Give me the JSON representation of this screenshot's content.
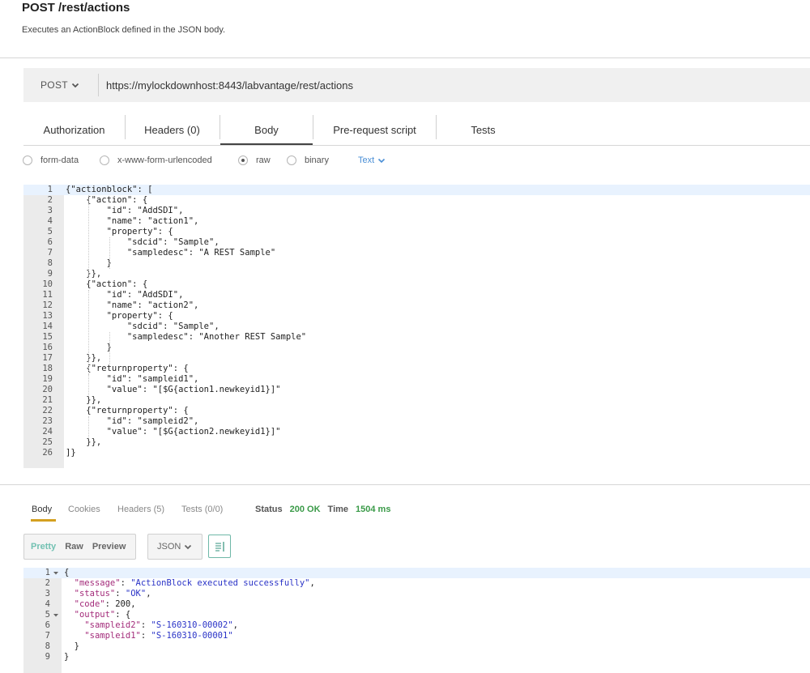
{
  "header": {
    "title": "POST /rest/actions",
    "subtitle": "Executes an ActionBlock defined in the JSON body."
  },
  "request": {
    "method": "POST",
    "url": "https://mylockdownhost:8443/labvantage/rest/actions"
  },
  "tabs": [
    {
      "label": "Authorization"
    },
    {
      "label": "Headers (0)"
    },
    {
      "label": "Body"
    },
    {
      "label": "Pre-request script"
    },
    {
      "label": "Tests"
    }
  ],
  "active_tab": "Body",
  "body_modes": [
    {
      "label": "form-data"
    },
    {
      "label": "x-www-form-urlencoded"
    },
    {
      "label": "raw"
    },
    {
      "label": "binary"
    }
  ],
  "selected_body_mode": "raw",
  "raw_type": "Text",
  "request_body_lines": [
    "{\"actionblock\": [",
    "    {\"action\": {",
    "        \"id\": \"AddSDI\",",
    "        \"name\": \"action1\",",
    "        \"property\": {",
    "            \"sdcid\": \"Sample\",",
    "            \"sampledesc\": \"A REST Sample\"",
    "        }",
    "    }},",
    "    {\"action\": {",
    "        \"id\": \"AddSDI\",",
    "        \"name\": \"action2\",",
    "        \"property\": {",
    "            \"sdcid\": \"Sample\",",
    "            \"sampledesc\": \"Another REST Sample\"",
    "        }",
    "    }},",
    "    {\"returnproperty\": {",
    "        \"id\": \"sampleid1\",",
    "        \"value\": \"[$G{action1.newkeyid1}]\"",
    "    }},",
    "    {\"returnproperty\": {",
    "        \"id\": \"sampleid2\",",
    "        \"value\": \"[$G{action2.newkeyid1}]\"",
    "    }},",
    "]}"
  ],
  "response": {
    "tabs": [
      {
        "label": "Body"
      },
      {
        "label": "Cookies"
      },
      {
        "label": "Headers (5)"
      },
      {
        "label": "Tests (0/0)"
      }
    ],
    "active_tab": "Body",
    "status_label": "Status",
    "status_value": "200 OK",
    "time_label": "Time",
    "time_value": "1504 ms",
    "view_modes": [
      {
        "label": "Pretty"
      },
      {
        "label": "Raw"
      },
      {
        "label": "Preview"
      }
    ],
    "selected_view_mode": "Pretty",
    "format": "JSON",
    "body_lines": [
      [
        {
          "t": "{",
          "c": "n"
        }
      ],
      [
        {
          "t": "  ",
          "c": "n"
        },
        {
          "t": "\"message\"",
          "c": "k"
        },
        {
          "t": ": ",
          "c": "n"
        },
        {
          "t": "\"ActionBlock executed successfully\"",
          "c": "s"
        },
        {
          "t": ",",
          "c": "n"
        }
      ],
      [
        {
          "t": "  ",
          "c": "n"
        },
        {
          "t": "\"status\"",
          "c": "k"
        },
        {
          "t": ": ",
          "c": "n"
        },
        {
          "t": "\"OK\"",
          "c": "s"
        },
        {
          "t": ",",
          "c": "n"
        }
      ],
      [
        {
          "t": "  ",
          "c": "n"
        },
        {
          "t": "\"code\"",
          "c": "k"
        },
        {
          "t": ": 200,",
          "c": "n"
        }
      ],
      [
        {
          "t": "  ",
          "c": "n"
        },
        {
          "t": "\"output\"",
          "c": "k"
        },
        {
          "t": ": {",
          "c": "n"
        }
      ],
      [
        {
          "t": "    ",
          "c": "n"
        },
        {
          "t": "\"sampleid2\"",
          "c": "k"
        },
        {
          "t": ": ",
          "c": "n"
        },
        {
          "t": "\"S-160310-00002\"",
          "c": "s"
        },
        {
          "t": ",",
          "c": "n"
        }
      ],
      [
        {
          "t": "    ",
          "c": "n"
        },
        {
          "t": "\"sampleid1\"",
          "c": "k"
        },
        {
          "t": ": ",
          "c": "n"
        },
        {
          "t": "\"S-160310-00001\"",
          "c": "s"
        }
      ],
      [
        {
          "t": "  }",
          "c": "n"
        }
      ],
      [
        {
          "t": "}",
          "c": "n"
        }
      ]
    ],
    "foldable_lines": [
      1,
      5
    ]
  }
}
